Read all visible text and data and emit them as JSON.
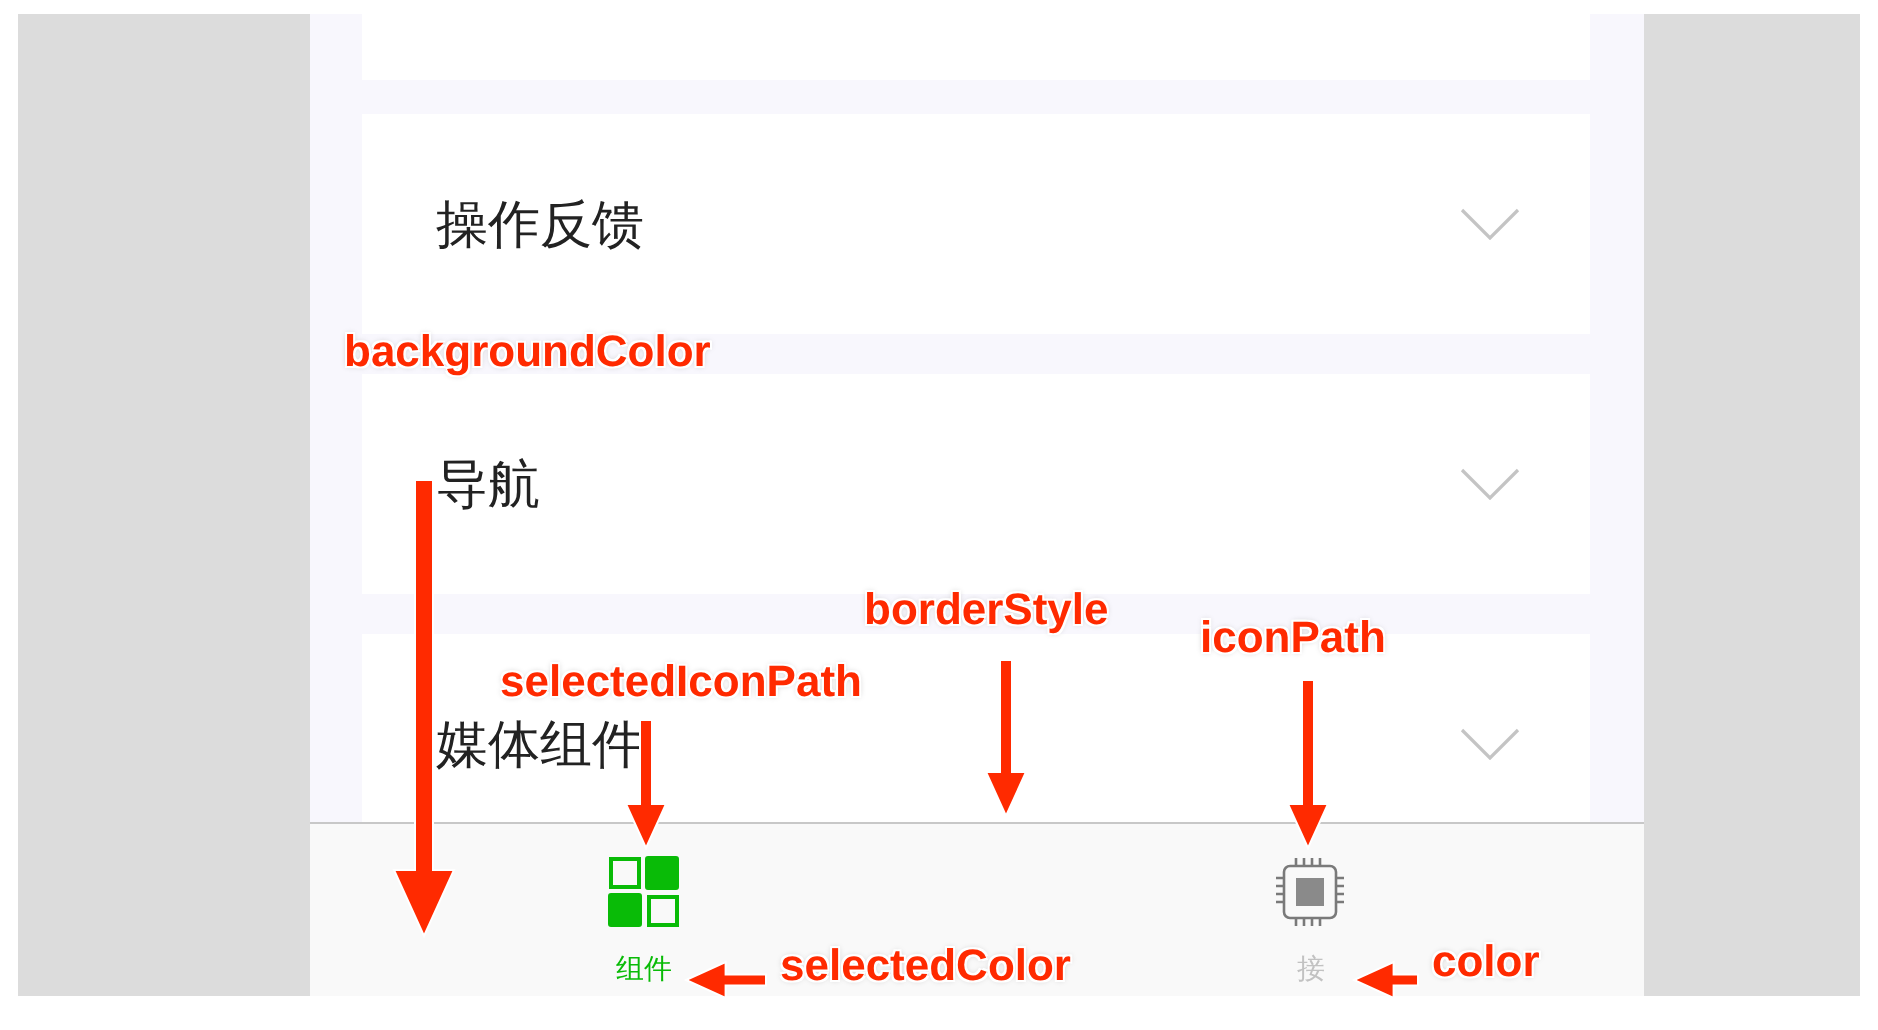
{
  "sections": [
    {
      "title": "操作反馈",
      "expanded": false
    },
    {
      "title": "导航",
      "expanded": false
    },
    {
      "title": "媒体组件",
      "expanded": false
    }
  ],
  "tab_bar": {
    "tabs": [
      {
        "label": "组件",
        "selected": true
      },
      {
        "label": "接",
        "selected": false
      }
    ]
  },
  "annotations": [
    {
      "text": "backgroundColor"
    },
    {
      "text": "borderStyle"
    },
    {
      "text": "selectedIconPath"
    },
    {
      "text": "iconPath"
    },
    {
      "text": "selectedColor"
    },
    {
      "text": "color"
    }
  ]
}
